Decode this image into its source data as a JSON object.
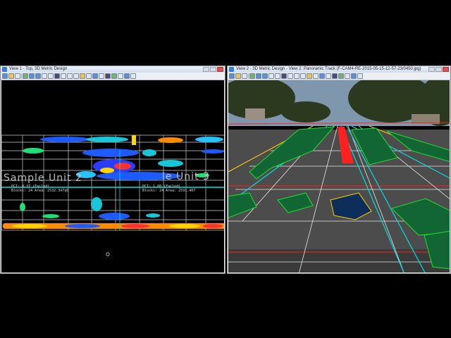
{
  "window_left": {
    "title": "View 1 - Top, 3D Metric Design",
    "sample_unit_2": "Sample Unit 2",
    "sample_unit_3": "le Unit 3",
    "info_left_line1": "PCI: 8.37 (Failed)",
    "info_left_line2": "Blocks: 24   Area: 2532.347q0",
    "info_right_line1": "PCI: 1.00 (Failed)",
    "info_right_line2": "Blocks: 24   Area: 2591.407"
  },
  "window_right": {
    "title": "View 2 - 3D Metric Design - View 2: Panoramic Track (F-CAM4-RE-2015-05-15-12-57-23/0450.jpg)"
  },
  "colors": {
    "accent_cyan": "#00e0e0",
    "crack_green": "#22dd33",
    "boundary_red": "#ff2020",
    "boundary_yellow": "#ffd400"
  }
}
